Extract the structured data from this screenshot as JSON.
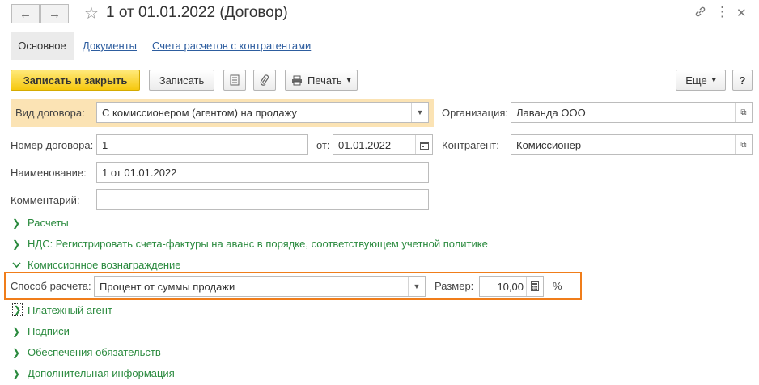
{
  "window": {
    "title": "1 от 01.01.2022 (Договор)",
    "back_icon": "←",
    "forward_icon": "→",
    "star_icon": "☆",
    "link_icon": "🔗",
    "menu_icon": "⋮",
    "close_icon": "✕"
  },
  "tabs": {
    "active": "Основное",
    "documents": "Документы",
    "accounts": "Счета расчетов с контрагентами"
  },
  "toolbar": {
    "save_close": "Записать и закрыть",
    "save": "Записать",
    "print": "Печать",
    "print_arrow": "▾",
    "more": "Еще",
    "more_arrow": "▾",
    "help": "?"
  },
  "form": {
    "contract_type_label": "Вид договора:",
    "contract_type_value": "С комиссионером (агентом) на продажу",
    "organization_label": "Организация:",
    "organization_value": "Лаванда ООО",
    "number_label": "Номер договора:",
    "number_value": "1",
    "date_label": "от:",
    "date_value": "01.01.2022",
    "counterparty_label": "Контрагент:",
    "counterparty_value": "Комиссионер",
    "name_label": "Наименование:",
    "name_value": "1 от 01.01.2022",
    "comment_label": "Комментарий:",
    "comment_value": ""
  },
  "groups": {
    "settlements": "Расчеты",
    "vat": "НДС: Регистрировать счета-фактуры на аванс в порядке, соответствующем учетной политике",
    "commission": "Комиссионное вознаграждение",
    "payment_agent": "Платежный агент",
    "signatures": "Подписи",
    "obligations": "Обеспечения обязательств",
    "additional": "Дополнительная информация"
  },
  "commission": {
    "method_label": "Способ расчета:",
    "method_value": "Процент от суммы продажи",
    "size_label": "Размер:",
    "size_value": "10,00",
    "unit": "%"
  },
  "colors": {
    "highlight_row": "#fbe3b4",
    "outline": "#f07d1a",
    "group_text": "#2a8a3e",
    "link": "#2d5d9f"
  }
}
